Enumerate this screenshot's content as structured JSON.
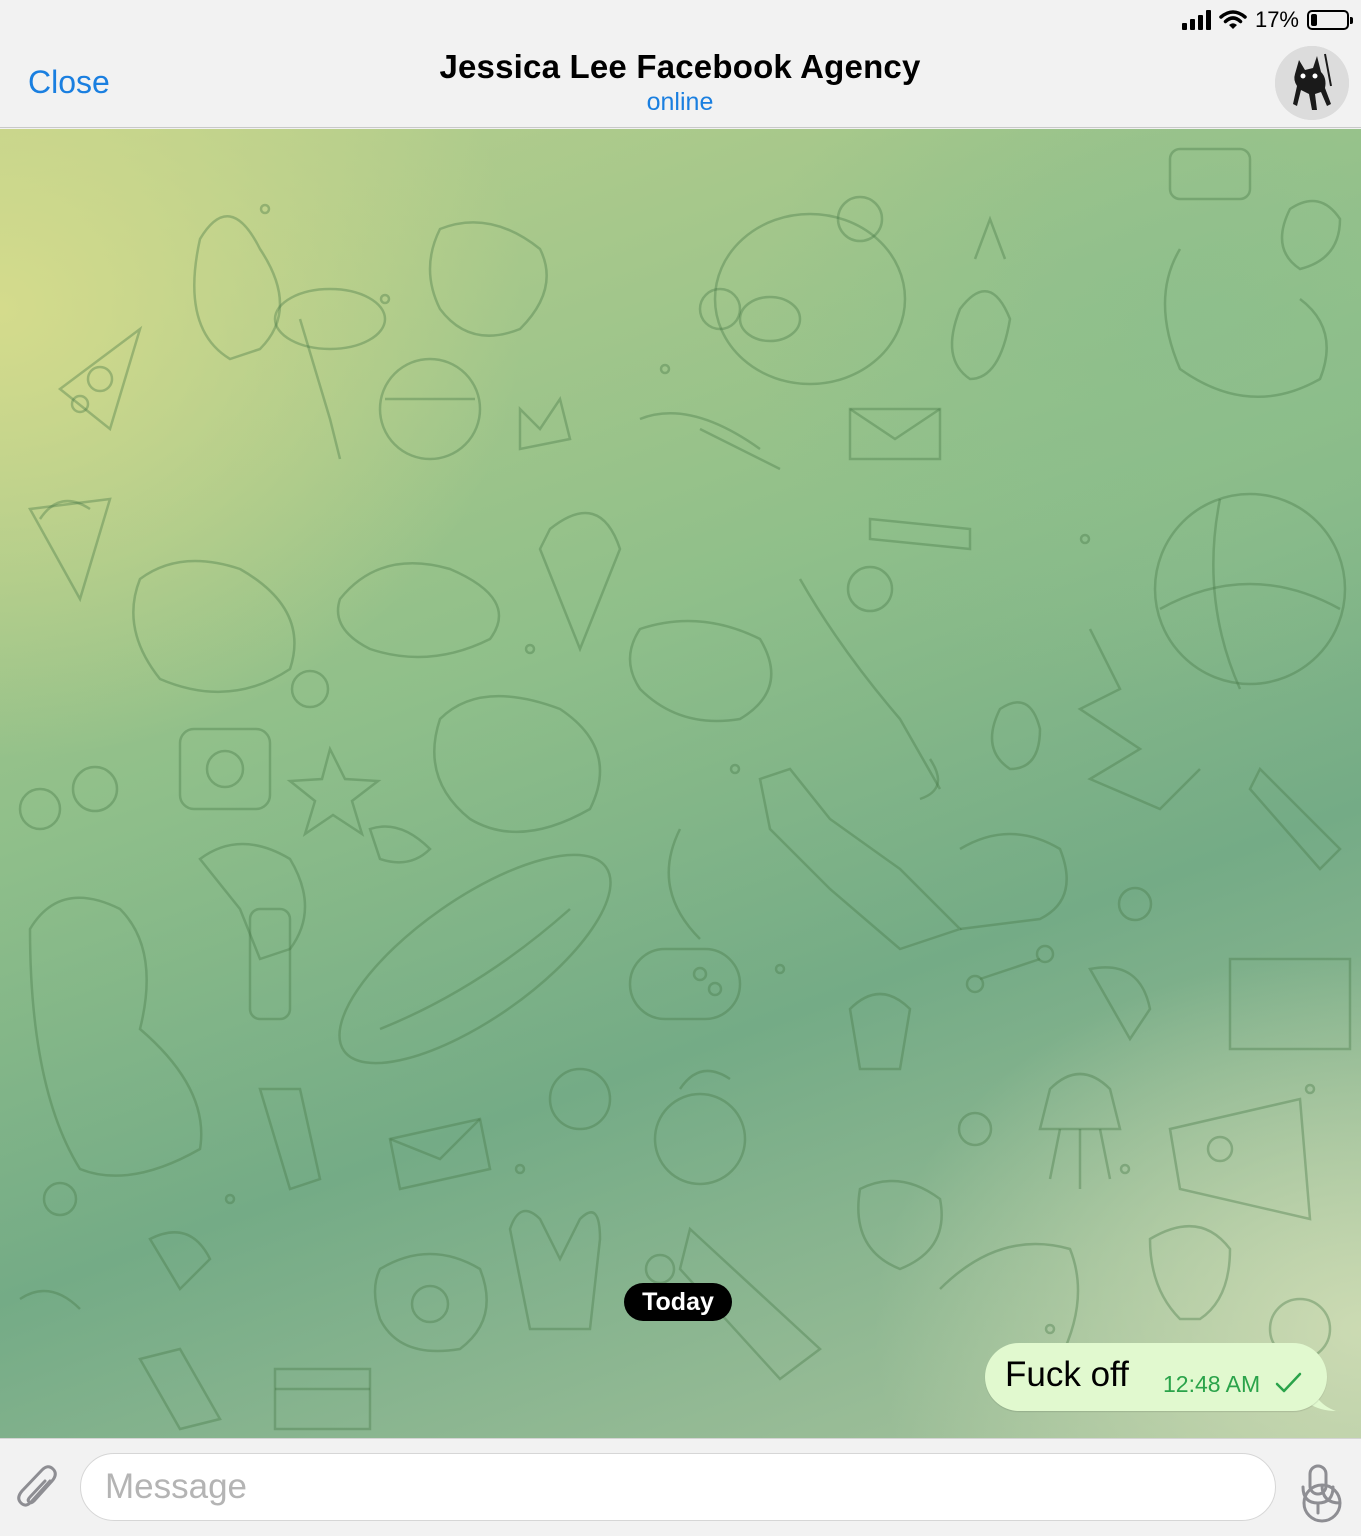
{
  "status_bar": {
    "battery_percent": "17%",
    "battery_level": 0.17
  },
  "header": {
    "close_label": "Close",
    "title": "Jessica Lee Facebook Agency",
    "status": "online"
  },
  "chat": {
    "date_separator": "Today",
    "messages": [
      {
        "text": "Fuck off",
        "time": "12:48 AM",
        "outgoing": true,
        "status_icon": "check-icon"
      }
    ]
  },
  "composer": {
    "placeholder": "Message"
  },
  "colors": {
    "accent": "#1a7fe0",
    "bubble": "#e1f9cf",
    "time_green": "#2aa34a"
  }
}
